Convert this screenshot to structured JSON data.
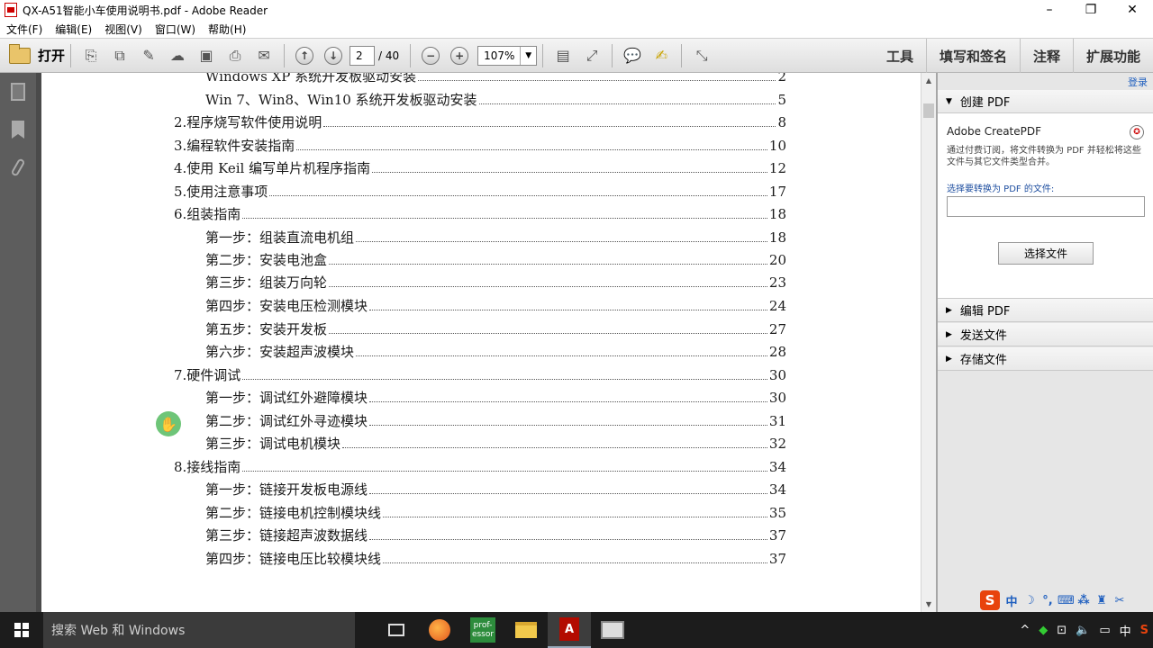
{
  "window": {
    "title": "QX-A51智能小车使用说明书.pdf - Adobe Reader",
    "minimize_glyph": "–",
    "maximize_glyph": "❐",
    "close_glyph": "✕"
  },
  "menu": [
    "文件(F)",
    "编辑(E)",
    "视图(V)",
    "窗口(W)",
    "帮助(H)"
  ],
  "toolbar": {
    "open_label": "打开",
    "page_current": "2",
    "page_total": "/ 40",
    "zoom": "107%",
    "right_buttons": [
      "工具",
      "填写和签名",
      "注释",
      "扩展功能"
    ]
  },
  "toc": [
    {
      "text": "Windows XP 系统开发板驱动安装",
      "page": "2"
    },
    {
      "text": "Win 7、Win8、Win10 系统开发板驱动安装",
      "page": "5"
    },
    {
      "text": "2.程序烧写软件使用说明",
      "page": "8"
    },
    {
      "text": "3.编程软件安装指南",
      "page": "10"
    },
    {
      "text": "4.使用 Keil 编写单片机程序指南",
      "page": "12"
    },
    {
      "text": "5.使用注意事项",
      "page": "17"
    },
    {
      "text": "6.组装指南",
      "page": "18"
    },
    {
      "text": "第一步：组装直流电机组",
      "page": "18"
    },
    {
      "text": "第二步：安装电池盒",
      "page": "20"
    },
    {
      "text": "第三步：组装万向轮",
      "page": "23"
    },
    {
      "text": "第四步：安装电压检测模块",
      "page": "24"
    },
    {
      "text": "第五步：安装开发板",
      "page": "27"
    },
    {
      "text": "第六步：安装超声波模块",
      "page": "28"
    },
    {
      "text": "7.硬件调试",
      "page": "30"
    },
    {
      "text": "第一步：调试红外避障模块",
      "page": "30"
    },
    {
      "text": "第二步：调试红外寻迹模块",
      "page": "31"
    },
    {
      "text": "第三步：调试电机模块",
      "page": "32"
    },
    {
      "text": "8.接线指南",
      "page": "34"
    },
    {
      "text": "第一步：链接开发板电源线",
      "page": "34"
    },
    {
      "text": "第二步：链接电机控制模块线",
      "page": "35"
    },
    {
      "text": "第三步：链接超声波数据线",
      "page": "37"
    },
    {
      "text": "第四步：链接电压比较模块线",
      "page": "37"
    }
  ],
  "panel": {
    "login": "登录",
    "create_pdf": "创建 PDF",
    "createpdf_title": "Adobe CreatePDF",
    "createpdf_desc": "通过付费订阅，将文件转换为 PDF 并轻松将这些文件与其它文件类型合并。",
    "select_label": "选择要转换为 PDF 的文件:",
    "select_button": "选择文件",
    "edit_pdf": "编辑 PDF",
    "send_file": "发送文件",
    "store_file": "存储文件"
  },
  "taskbar": {
    "search_placeholder": "搜索 Web 和 Windows",
    "green_app_label": "prof-essor",
    "pdf_label": "A",
    "tray_ime": "中"
  },
  "ime_bar": {
    "logo": "S",
    "mode": "中"
  }
}
